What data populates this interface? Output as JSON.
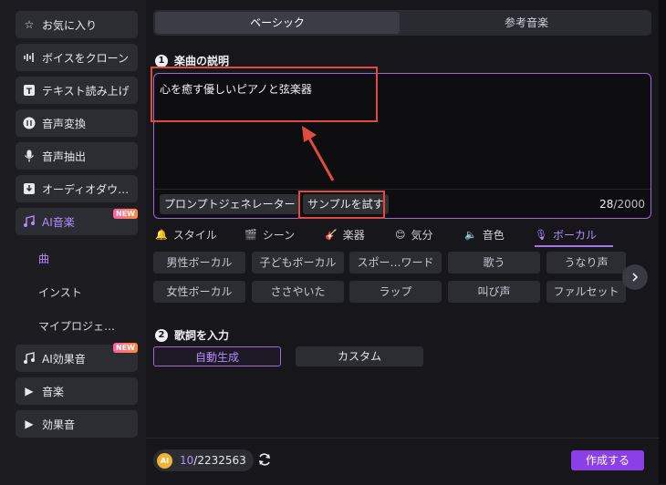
{
  "sidebar": {
    "items": [
      {
        "label": "お気に入り",
        "icon": "star-icon"
      },
      {
        "label": "ボイスをクローン",
        "icon": "waveform-icon"
      },
      {
        "label": "テキスト読み上げ",
        "icon": "tts-icon"
      },
      {
        "label": "音声変換",
        "icon": "voice-change-icon"
      },
      {
        "label": "音声抽出",
        "icon": "microphone-icon"
      },
      {
        "label": "オーディオダウ…",
        "icon": "download-icon"
      },
      {
        "label": "AI音楽",
        "icon": "music-note-icon",
        "badge": "NEW"
      }
    ],
    "sub_items": [
      {
        "label": "曲",
        "active": true
      },
      {
        "label": "インスト",
        "active": false
      },
      {
        "label": "マイプロジェ…",
        "active": false
      }
    ],
    "items2": [
      {
        "label": "AI効果音",
        "icon": "sound-effect-icon",
        "badge": "NEW"
      },
      {
        "label": "音楽",
        "icon": "caret-right-icon"
      },
      {
        "label": "効果音",
        "icon": "caret-right-icon"
      }
    ]
  },
  "tabs": [
    {
      "label": "ベーシック",
      "active": true
    },
    {
      "label": "参考音楽",
      "active": false
    }
  ],
  "section1": {
    "number": "1",
    "title": "楽曲の説明"
  },
  "description": {
    "value": "心を癒す優しいピアノと弦楽器",
    "prompt_generator_label": "プロンプトジェネレーター",
    "try_sample_label": "サンプルを試す",
    "count_current": "28",
    "count_max": "/2000"
  },
  "categories": [
    {
      "label": "スタイル",
      "icon": "bell-icon",
      "glyph": "🔔",
      "active": false
    },
    {
      "label": "シーン",
      "icon": "clapper-icon",
      "glyph": "🎬",
      "active": false
    },
    {
      "label": "楽器",
      "icon": "guitar-icon",
      "glyph": "🎸",
      "active": false
    },
    {
      "label": "気分",
      "icon": "smile-icon",
      "glyph": "😊",
      "active": false
    },
    {
      "label": "音色",
      "icon": "speaker-icon",
      "glyph": "🔈",
      "active": false
    },
    {
      "label": "ボーカル",
      "icon": "vocal-icon",
      "glyph": "🎙",
      "active": true
    }
  ],
  "chips_row1": [
    "男性ボーカル",
    "子どもボーカル",
    "スポー…ワード",
    "歌う",
    "うなり声"
  ],
  "chips_row2": [
    "女性ボーカル",
    "ささやいた",
    "ラップ",
    "叫び声",
    "ファルセット"
  ],
  "section2": {
    "number": "2",
    "title": "歌詞を入力"
  },
  "lyrics_options": [
    {
      "label": "自動生成",
      "active": true
    },
    {
      "label": "カスタム",
      "active": false
    }
  ],
  "footer": {
    "coin_label": "AI",
    "credits_used": "10",
    "credits_total": "/2232563",
    "create_label": "作成する"
  },
  "colors": {
    "accent": "#9a6bdb",
    "highlight": "#e04a3f",
    "create": "#8b3fe6"
  }
}
